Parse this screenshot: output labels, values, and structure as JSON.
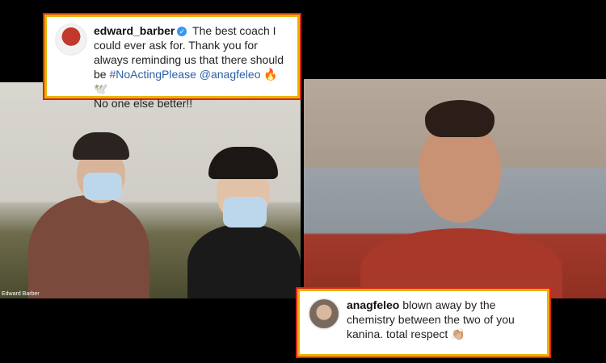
{
  "top_comment": {
    "username": "edward_barber",
    "text_before_tags": "The best coach I could ever ask for. Thank you for always reminding us that there should be",
    "hashtag": "#NoActingPlease",
    "mention": "@anagfeleo",
    "emojis": "🔥🕊️",
    "text_after": "No one else better!!"
  },
  "bottom_comment": {
    "username": "anagfeleo",
    "text": "blown away by the chemistry between the two of you kanina. total respect",
    "emoji": "👏🏼"
  },
  "left_video": {
    "name_tag": "Edward Barber"
  },
  "colors": {
    "highlight_border": "#e8b400",
    "outer_border": "#dd2222",
    "link": "#2b5fa8"
  }
}
